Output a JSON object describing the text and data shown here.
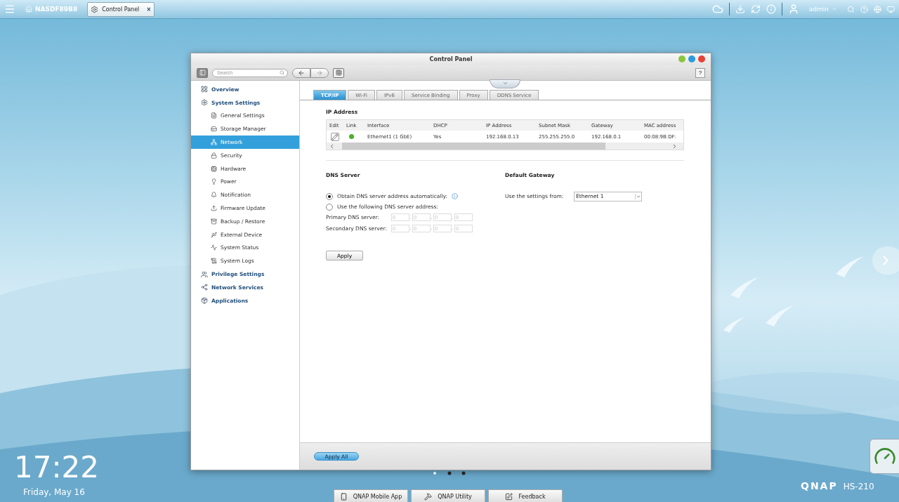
{
  "taskbar": {
    "home_label": "NASDF89B8",
    "open_app": {
      "label": "Control Panel",
      "close": "×"
    },
    "user": "admin"
  },
  "window": {
    "title": "Control Panel",
    "search": {
      "placeholder": "Search"
    },
    "help": "?"
  },
  "sidebar": {
    "items": [
      {
        "label": "Overview",
        "selected": false
      },
      {
        "label": "System Settings",
        "selected": false,
        "children": [
          {
            "label": "General Settings",
            "selected": false
          },
          {
            "label": "Storage Manager",
            "selected": false
          },
          {
            "label": "Network",
            "selected": true
          },
          {
            "label": "Security",
            "selected": false
          },
          {
            "label": "Hardware",
            "selected": false
          },
          {
            "label": "Power",
            "selected": false
          },
          {
            "label": "Notification",
            "selected": false
          },
          {
            "label": "Firmware Update",
            "selected": false
          },
          {
            "label": "Backup / Restore",
            "selected": false
          },
          {
            "label": "External Device",
            "selected": false
          },
          {
            "label": "System Status",
            "selected": false
          },
          {
            "label": "System Logs",
            "selected": false
          }
        ]
      },
      {
        "label": "Privilege Settings",
        "selected": false
      },
      {
        "label": "Network Services",
        "selected": false
      },
      {
        "label": "Applications",
        "selected": false
      }
    ]
  },
  "tabs": [
    {
      "label": "TCP/IP",
      "selected": true
    },
    {
      "label": "Wi-Fi",
      "selected": false
    },
    {
      "label": "IPv6",
      "selected": false
    },
    {
      "label": "Service Binding",
      "selected": false
    },
    {
      "label": "Proxy",
      "selected": false
    },
    {
      "label": "DDNS Service",
      "selected": false
    }
  ],
  "ip_address": {
    "title": "IP Address",
    "columns": [
      "Edit",
      "Link",
      "Interface",
      "DHCP",
      "IP Address",
      "Subnet Mask",
      "Gateway",
      "MAC address"
    ],
    "rows": [
      {
        "link_up": true,
        "cells": [
          "",
          "",
          "Ethernet1 (1 GbE)",
          "Yes",
          "192.168.0.13",
          "255.255.255.0",
          "192.168.0.1",
          "00:08:9B:DF:"
        ]
      }
    ]
  },
  "dns_server": {
    "title": "DNS Server",
    "options": [
      {
        "label": "Obtain DNS server address automatically:",
        "selected": true,
        "info": true
      },
      {
        "label": "Use the following DNS server address:",
        "selected": false,
        "info": false
      }
    ],
    "fields": [
      {
        "label": "Primary DNS server:",
        "disabled": true,
        "octets": [
          "0",
          "0",
          "0",
          "0"
        ]
      },
      {
        "label": "Secondary DNS server:",
        "disabled": true,
        "octets": [
          "0",
          "0",
          "0",
          "0"
        ]
      }
    ],
    "separator": ".",
    "apply": "Apply"
  },
  "default_gateway": {
    "title": "Default Gateway",
    "label": "Use the settings from:",
    "value": "Ethernet 1"
  },
  "footer": {
    "apply_all": "Apply All"
  },
  "desktop": {
    "time": "17:22",
    "date": "Friday, May 16",
    "brand": "QNAP",
    "model": "HS-210",
    "dock": [
      "QNAP Mobile App",
      "QNAP Utility",
      "Feedback"
    ]
  }
}
